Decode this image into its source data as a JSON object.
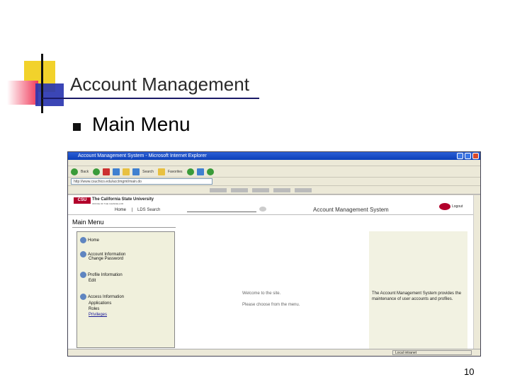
{
  "slide": {
    "title": "Account Management",
    "heading": "Main Menu",
    "page_number": "10"
  },
  "browser": {
    "window_title": "Account Management System - Microsoft Internet Explorer",
    "address": "http://www.csuchico.edu/acctmgmt/main.do",
    "toolbar": {
      "back_label": "Back",
      "search_label": "Search",
      "favorites_label": "Favorites"
    },
    "status_text": "Local intranet",
    "page": {
      "logo": "CSU",
      "university_name": "The California State University",
      "university_sub": "OFFICE OF THE CHANCELLOR",
      "nav_home": "Home",
      "nav_separator": "|",
      "nav_search": "LDS Search",
      "system_title": "Account Management System",
      "logout_label": "Logout",
      "main_menu": "Main Menu",
      "nav": [
        {
          "label": "Home",
          "subs": []
        },
        {
          "label": "Account Information",
          "subs": [
            "Change Password"
          ]
        },
        {
          "label": "Profile Information",
          "subs": [
            "Edit"
          ]
        },
        {
          "label": "Access Information",
          "subs": [
            "Applications",
            "Roles",
            "Privileges"
          ]
        }
      ],
      "welcome_text": "Welcome to the site.",
      "choose_text": "Please choose from the menu.",
      "description": "The Account Management System provides the maintenance of user accounts and profiles."
    }
  }
}
